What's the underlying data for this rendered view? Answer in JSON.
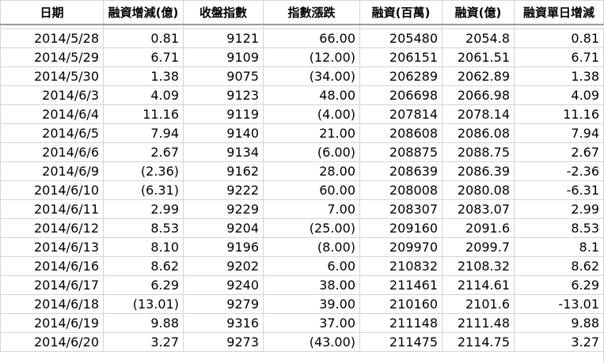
{
  "sheet": {
    "headers": [
      "日期",
      "融資增減(億)",
      "收盤指數",
      "指數漲跌",
      "融資(百萬)",
      "融資(億)",
      "融資單日增減"
    ],
    "colors": {
      "negative": "#ff0000",
      "grid": "#d4d4d4",
      "text": "#000000"
    },
    "rows": [
      [
        "2014/5/28",
        "0.81",
        "9121",
        "66.00",
        "205480",
        "2054.8",
        "0.81"
      ],
      [
        "2014/5/29",
        "6.71",
        "9109",
        "(12.00)",
        "206151",
        "2061.51",
        "6.71"
      ],
      [
        "2014/5/30",
        "1.38",
        "9075",
        "(34.00)",
        "206289",
        "2062.89",
        "1.38"
      ],
      [
        "2014/6/3",
        "4.09",
        "9123",
        "48.00",
        "206698",
        "2066.98",
        "4.09"
      ],
      [
        "2014/6/4",
        "11.16",
        "9119",
        "(4.00)",
        "207814",
        "2078.14",
        "11.16"
      ],
      [
        "2014/6/5",
        "7.94",
        "9140",
        "21.00",
        "208608",
        "2086.08",
        "7.94"
      ],
      [
        "2014/6/6",
        "2.67",
        "9134",
        "(6.00)",
        "208875",
        "2088.75",
        "2.67"
      ],
      [
        "2014/6/9",
        "(2.36)",
        "9162",
        "28.00",
        "208639",
        "2086.39",
        "-2.36"
      ],
      [
        "2014/6/10",
        "(6.31)",
        "9222",
        "60.00",
        "208008",
        "2080.08",
        "-6.31"
      ],
      [
        "2014/6/11",
        "2.99",
        "9229",
        "7.00",
        "208307",
        "2083.07",
        "2.99"
      ],
      [
        "2014/6/12",
        "8.53",
        "9204",
        "(25.00)",
        "209160",
        "2091.6",
        "8.53"
      ],
      [
        "2014/6/13",
        "8.10",
        "9196",
        "(8.00)",
        "209970",
        "2099.7",
        "8.1"
      ],
      [
        "2014/6/16",
        "8.62",
        "9202",
        "6.00",
        "210832",
        "2108.32",
        "8.62"
      ],
      [
        "2014/6/17",
        "6.29",
        "9240",
        "38.00",
        "211461",
        "2114.61",
        "6.29"
      ],
      [
        "2014/6/18",
        "(13.01)",
        "9279",
        "39.00",
        "210160",
        "2101.6",
        "-13.01"
      ],
      [
        "2014/6/19",
        "9.88",
        "9316",
        "37.00",
        "211148",
        "2111.48",
        "9.88"
      ],
      [
        "2014/6/20",
        "3.27",
        "9273",
        "(43.00)",
        "211475",
        "2114.75",
        "3.27"
      ]
    ]
  }
}
